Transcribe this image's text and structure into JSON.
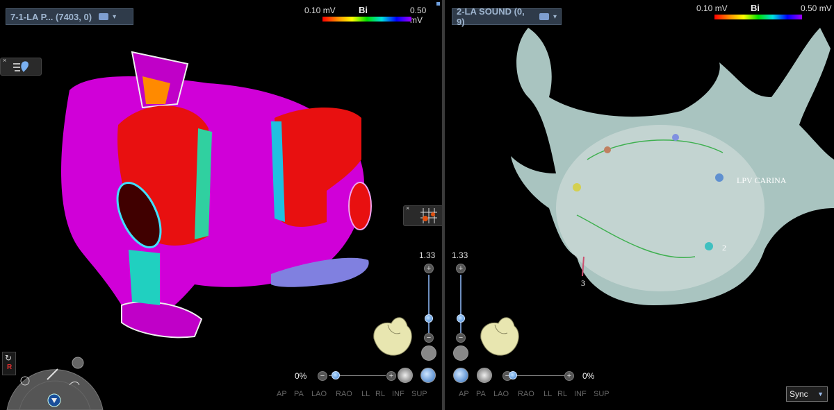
{
  "left_view": {
    "title": "7-1-LA P... (7403, 0)",
    "scale": {
      "min": "0.10 mV",
      "max": "0.50 mV",
      "mode": "Bi"
    },
    "zoom": "1.33",
    "opacity": "0%",
    "views": [
      "AP",
      "PA",
      "LAO",
      "RAO",
      "LL",
      "RL",
      "INF",
      "SUP"
    ]
  },
  "right_view": {
    "title": "2-LA SOUND (0, 9)",
    "scale": {
      "min": "0.10 mV",
      "max": "0.50 mV",
      "mode": "Bi"
    },
    "zoom": "1.33",
    "opacity": "0%",
    "views": [
      "AP",
      "PA",
      "LAO",
      "RAO",
      "LL",
      "RL",
      "INF",
      "SUP"
    ],
    "markers": [
      {
        "label": "LPV CARINA"
      },
      {
        "label": "2"
      },
      {
        "label": "3"
      }
    ]
  },
  "sync": {
    "label": "Sync"
  },
  "controls": {
    "plus": "+",
    "minus": "−",
    "close": "×"
  },
  "colors": {
    "title_bg": "#2f3b4a",
    "title_text": "#9fb6d0",
    "map_magenta": "#d000d8",
    "map_red": "#e81010",
    "shell_gray": "#a9c4c0"
  },
  "icons": [
    "caret-down-icon",
    "heart-icon",
    "anatomy-heart-icon",
    "hand-icon",
    "wand-icon",
    "filter-icon",
    "view-sync-icon"
  ]
}
